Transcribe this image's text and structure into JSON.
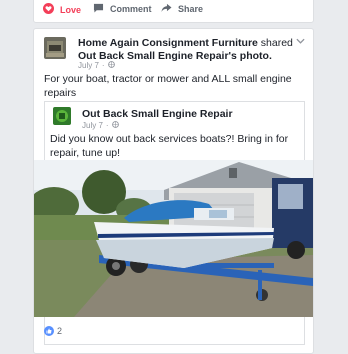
{
  "top_actions": {
    "love_label": "Love",
    "comment_label": "Comment",
    "share_label": "Share"
  },
  "post": {
    "author": "Home Again Consignment Furniture",
    "shared_word": "shared",
    "shared_page": "Out Back Small Engine Repair",
    "possessive": "'s photo.",
    "date": "July 7",
    "separator": "·",
    "message": "For your boat, tractor or mower and ALL small engine repairs",
    "shared_post": {
      "author": "Out Back Small Engine Repair",
      "date": "July 7",
      "separator": "·",
      "message": "Did you know out back services boats?! Bring in for repair, tune up!"
    },
    "reaction_count": "2"
  },
  "colors": {
    "love": "#f33e58",
    "like": "#5890ff",
    "boat_cover": "#2b79c2",
    "trailer": "#2a63b8"
  },
  "icons": [
    "love-icon",
    "comment-icon",
    "share-icon",
    "globe-icon",
    "chevron-down-icon",
    "like-icon"
  ]
}
